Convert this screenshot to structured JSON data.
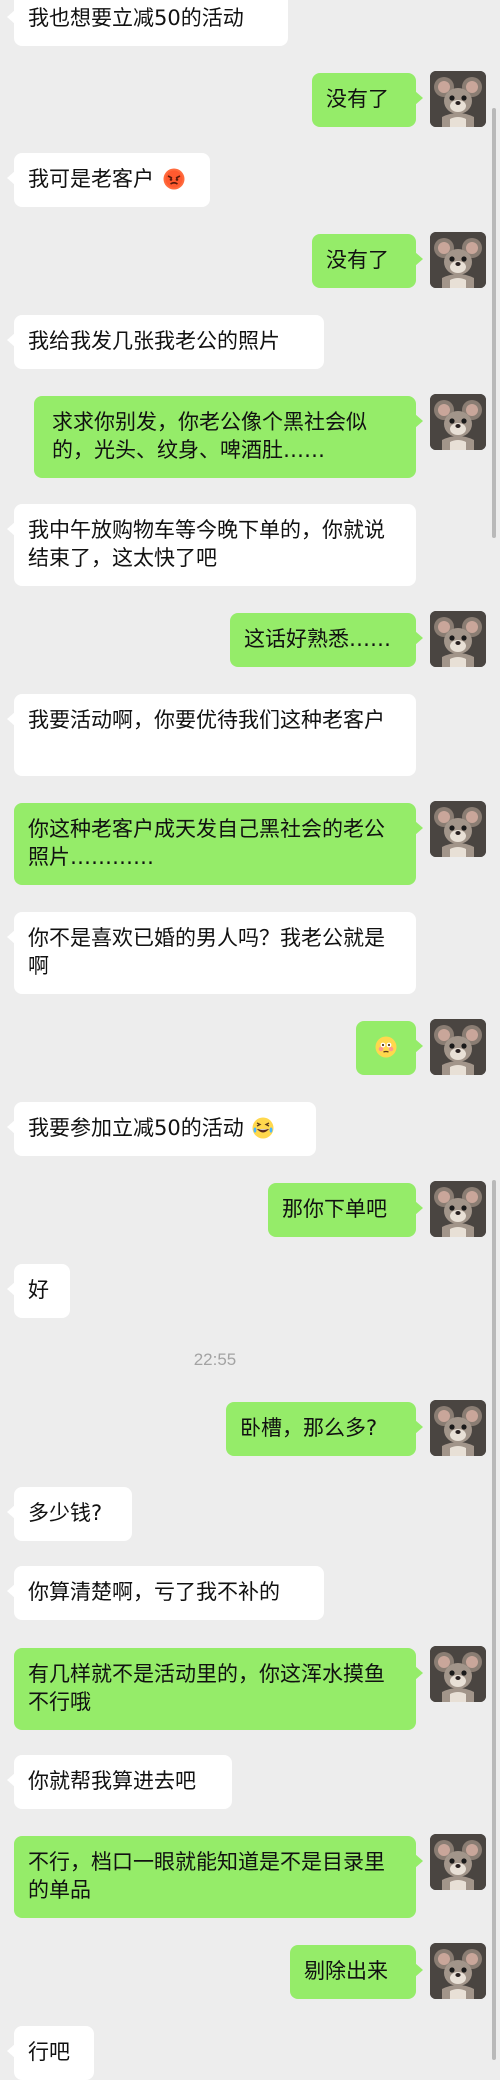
{
  "theme": {
    "background": "#ededed",
    "incoming_bubble": "#ffffff",
    "outgoing_bubble": "#95ec69",
    "timestamp_color": "#a3a3a3"
  },
  "messages": [
    {
      "side": "left",
      "text": "我也想要立减50的活动"
    },
    {
      "side": "right",
      "text": "没有了",
      "avatar": "mouse-avatar"
    },
    {
      "side": "left",
      "text": "我可是老客户",
      "emoji": "angry-face"
    },
    {
      "side": "right",
      "text": "没有了",
      "avatar": "mouse-avatar"
    },
    {
      "side": "left",
      "text": "我给我发几张我老公的照片"
    },
    {
      "side": "right",
      "text": "求求你别发，你老公像个黑社会似的，光头、纹身、啤酒肚……",
      "avatar": "mouse-avatar"
    },
    {
      "side": "left",
      "text": "我中午放购物车等今晚下单的，你就说结束了，这太快了吧"
    },
    {
      "side": "right",
      "text": "这话好熟悉……",
      "avatar": "mouse-avatar"
    },
    {
      "side": "left",
      "text": "我要活动啊，你要优待我们这种老客户"
    },
    {
      "side": "right",
      "text": "你这种老客户成天发自己黑社会的老公照片…………",
      "avatar": "mouse-avatar"
    },
    {
      "side": "left",
      "text": "你不是喜欢已婚的男人吗？我老公就是啊"
    },
    {
      "side": "right",
      "text": "",
      "emoji": "flushed-face",
      "avatar": "mouse-avatar"
    },
    {
      "side": "left",
      "text": "我要参加立减50的活动",
      "emoji": "laughing-tears-face"
    },
    {
      "side": "right",
      "text": "那你下单吧",
      "avatar": "mouse-avatar"
    },
    {
      "side": "left",
      "text": "好"
    },
    {
      "side": "right",
      "text": "卧槽，那么多?",
      "avatar": "mouse-avatar"
    },
    {
      "side": "left",
      "text": "多少钱?"
    },
    {
      "side": "left",
      "text": "你算清楚啊，亏了我不补的"
    },
    {
      "side": "right",
      "text": "有几样就不是活动里的，你这浑水摸鱼不行哦",
      "avatar": "mouse-avatar"
    },
    {
      "side": "left",
      "text": "你就帮我算进去吧"
    },
    {
      "side": "right",
      "text": "不行，档口一眼就能知道是不是目录里的单品",
      "avatar": "mouse-avatar"
    },
    {
      "side": "right",
      "text": "剔除出来",
      "avatar": "mouse-avatar"
    },
    {
      "side": "left",
      "text": "行吧"
    }
  ],
  "timestamp": "22:55"
}
